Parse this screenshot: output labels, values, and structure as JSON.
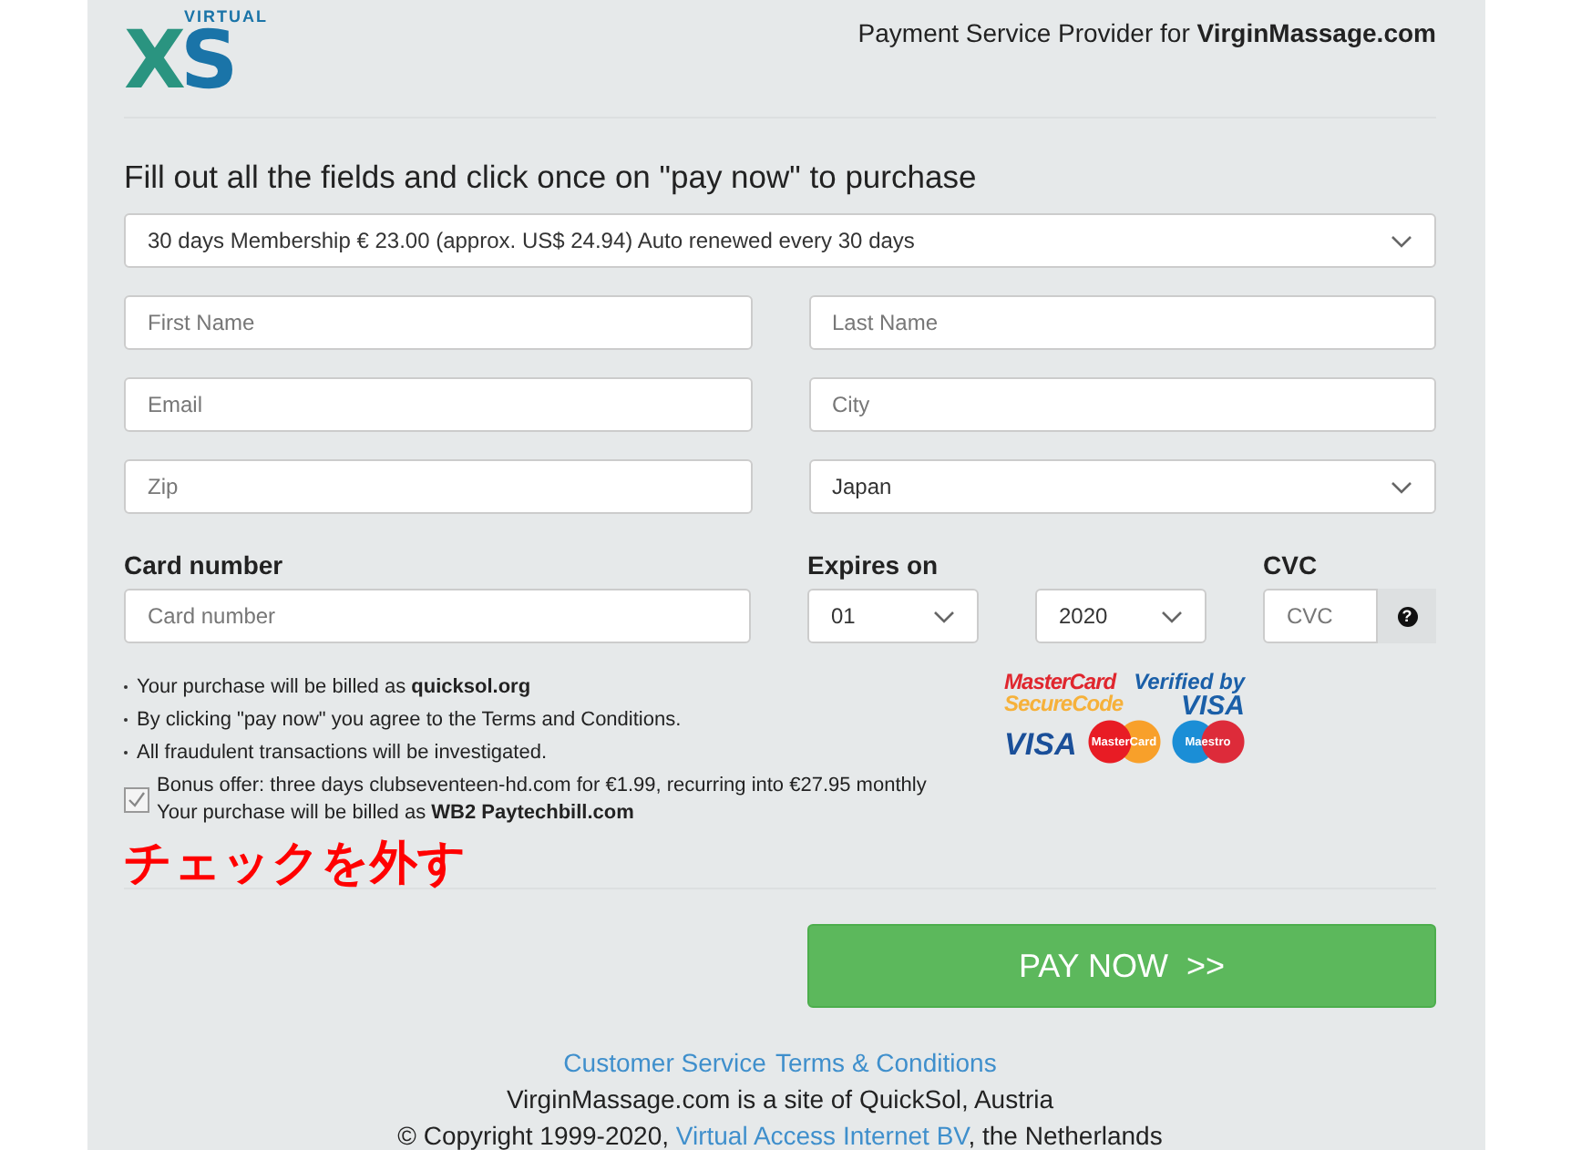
{
  "logo": {
    "tagline": "VIRTUAL",
    "mark": "XS"
  },
  "provider": "Payment Service Provider for **VirginMassage.com**",
  "heading": "Fill out all the fields and click once on \"pay now\" to purchase",
  "plan": {
    "value": "30 days Membership € 23.00 (approx. US$ 24.94) Auto renewed every 30 days"
  },
  "fields": [
    {
      "kind": "input",
      "placeholder": "First Name"
    },
    {
      "kind": "input",
      "placeholder": "Last Name"
    },
    {
      "kind": "input",
      "placeholder": "Email"
    },
    {
      "kind": "input",
      "placeholder": "City"
    },
    {
      "kind": "input",
      "placeholder": "Zip"
    },
    {
      "kind": "select",
      "value": "Japan"
    }
  ],
  "card": {
    "label": "Card number",
    "placeholder": "Card number"
  },
  "expires": {
    "label": "Expires on",
    "month": "01",
    "year": "2020"
  },
  "cvc": {
    "label": "CVC",
    "placeholder": "CVC",
    "help": "?"
  },
  "notes": [
    "Your purchase will be billed as **quicksol.org**",
    "By clicking \"pay now\" you agree to the Terms and Conditions.",
    "All fraudulent transactions will be investigated."
  ],
  "bonus": {
    "checked": true,
    "lines": [
      "Bonus offer: three days clubseventeen-hd.com for €1.99, recurring into €27.95 monthly",
      "Your purchase will be billed as **WB2 Paytechbill.com**"
    ]
  },
  "annotation": "チェックを外す",
  "card_logos": {
    "securecode": [
      "MasterCard",
      "SecureCode"
    ],
    "verified": [
      "Verified by",
      "VISA"
    ],
    "visa": "VISA",
    "mastercard": "MasterCard",
    "maestro": "Maestro"
  },
  "pay_button": "PAY NOW  >>",
  "footer": {
    "links": [
      "Customer Service",
      "Terms & Conditions"
    ],
    "site": "VirginMassage.com is a site of QuickSol, Austria",
    "copyright": {
      "before": "© Copyright 1999-2020,",
      "link": "Virtual Access Internet BV",
      "after": ", the Netherlands"
    }
  }
}
